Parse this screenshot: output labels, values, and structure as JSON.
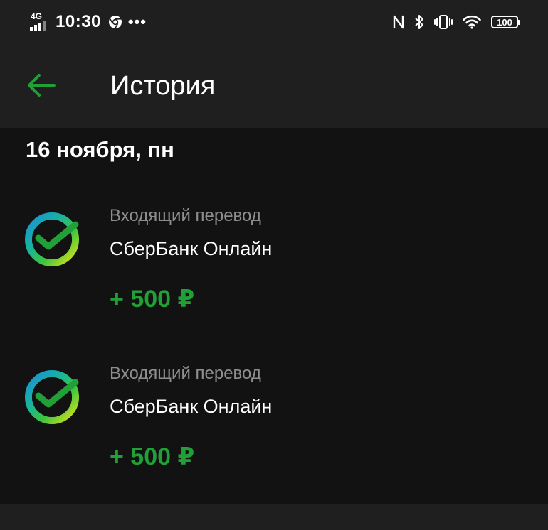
{
  "status_bar": {
    "network": "4G",
    "time": "10:30",
    "more": "•••",
    "battery": "100",
    "icons": [
      "chrome-icon",
      "nfc-icon",
      "bluetooth-icon",
      "vibrate-icon",
      "wifi-icon",
      "battery-icon"
    ]
  },
  "app_bar": {
    "back_icon": "arrow-left-icon",
    "title": "История"
  },
  "date_group": {
    "label": "16 ноября, пн"
  },
  "transactions": [
    {
      "type": "Входящий перевод",
      "merchant": "СберБанк Онлайн",
      "amount": "+ 500 ₽",
      "logo": "sber-logo-icon"
    },
    {
      "type": "Входящий перевод",
      "merchant": "СберБанк Онлайн",
      "amount": "+ 500 ₽",
      "logo": "sber-logo-icon"
    }
  ],
  "colors": {
    "accent": "#21a038",
    "background": "#121212",
    "surface": "#1f1f1f",
    "secondary_text": "#8e8e8e",
    "primary_text": "#ffffff"
  }
}
